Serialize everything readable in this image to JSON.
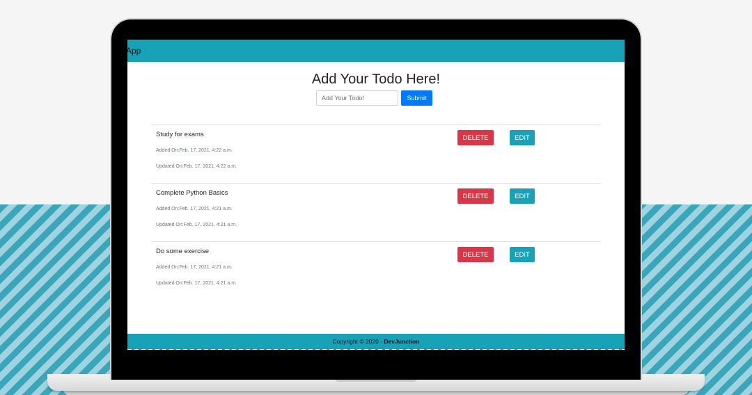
{
  "navbar": {
    "brand": "App"
  },
  "main": {
    "heading": "Add Your Todo Here!",
    "input_placeholder": "Add Your Todo!",
    "submit_label": "Submit"
  },
  "todos": [
    {
      "title": "Study for exams",
      "added": "Added On:Feb. 17, 2021, 4:22 a.m.",
      "updated": "Updated On:Feb. 17, 2021, 4:22 a.m.",
      "delete_label": "DELETE",
      "edit_label": "EDIT"
    },
    {
      "title": "Complete Python Basics",
      "added": "Added On:Feb. 17, 2021, 4:21 a.m.",
      "updated": "Updated On:Feb. 17, 2021, 4:21 a.m.",
      "delete_label": "DELETE",
      "edit_label": "EDIT"
    },
    {
      "title": "Do some exercise",
      "added": "Added On:Feb. 17, 2021, 4:21 a.m.",
      "updated": "Updated On:Feb. 17, 2021, 4:21 a.m.",
      "delete_label": "DELETE",
      "edit_label": "EDIT"
    }
  ],
  "footer": {
    "text": "Copyright © 2020 - ",
    "brand": "DevJunction"
  },
  "colors": {
    "navbar": "#17a2b8",
    "submit": "#007bff",
    "delete": "#dc3545",
    "edit": "#17a2b8",
    "stripe_dark": "#3aa6b9",
    "stripe_light": "#9fd3df"
  }
}
